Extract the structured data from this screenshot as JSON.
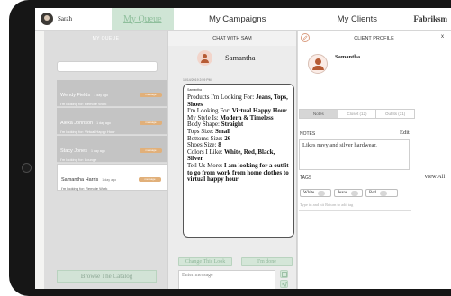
{
  "nav": {
    "user_name": "Sarah",
    "tabs": [
      "My Queue",
      "My Campaigns",
      "My Clients"
    ],
    "brand": "Fabriksm"
  },
  "queue": {
    "header": "MY QUEUE",
    "items": [
      {
        "name": "Wendy Fields",
        "time": "1 day ago",
        "sub": "I'm looking for: Remote Work",
        "badge": "message"
      },
      {
        "name": "Alexa Johnson",
        "time": "1 day ago",
        "sub": "I'm looking for: Virtual Happy Hour",
        "badge": "message"
      },
      {
        "name": "Stacy Jones",
        "time": "1 day ago",
        "sub": "I'm looking for: Lounge",
        "badge": "message"
      },
      {
        "name": "Samantha Harris",
        "time": "1 day ago",
        "sub": "I'm looking for: Remote Work",
        "badge": "message"
      }
    ],
    "browse_label": "Browse The Catalog"
  },
  "chat": {
    "header": "CHAT WITH SAM",
    "user_name": "Samantha",
    "timestamp": "10/14/2019 2:59 PM",
    "sender": "Samantha",
    "message": [
      {
        "k": "Products I'm Looking For: ",
        "v": "Jeans, Tops, Shoes"
      },
      {
        "k": "I'm Looking For: ",
        "v": "Virtual Happy Hour"
      },
      {
        "k": "My Style Is: ",
        "v": "Modern & Timeless"
      },
      {
        "k": "Body Shape: ",
        "v": "Straight"
      },
      {
        "k": "Tops Size: ",
        "v": "Small"
      },
      {
        "k": "Bottoms Size: ",
        "v": "26"
      },
      {
        "k": "Shoes Size: ",
        "v": "8"
      },
      {
        "k": "Colors I Like: ",
        "v": "White, Red, Black, Silver"
      },
      {
        "k": "Tell Us More: ",
        "v": "I am looking for a outfit to go from work from home clothes to virtual happy hour"
      }
    ],
    "change_look_label": "Change This Look",
    "done_label": "I'm done",
    "input_placeholder": "Enter message"
  },
  "profile": {
    "header": "CLIENT PROFILE",
    "close_label": "x",
    "name": "Samantha",
    "tabs": [
      "Notes",
      "Closet (12)",
      "Outfits (31)"
    ],
    "notes_label": "NOTES",
    "notes_edit": "Edit",
    "notes_text": "Likes navy and silver hardwear.",
    "tags_label": "TAGS",
    "tags_view_all": "View All",
    "tags": [
      "White",
      "Jeans",
      "Red"
    ],
    "tag_hint": "Type in and hit Return to add tag"
  },
  "colors": {
    "accent_green": "#cfe5d5",
    "badge_orange": "#e1b07a",
    "avatar_rust": "#b65b34"
  }
}
